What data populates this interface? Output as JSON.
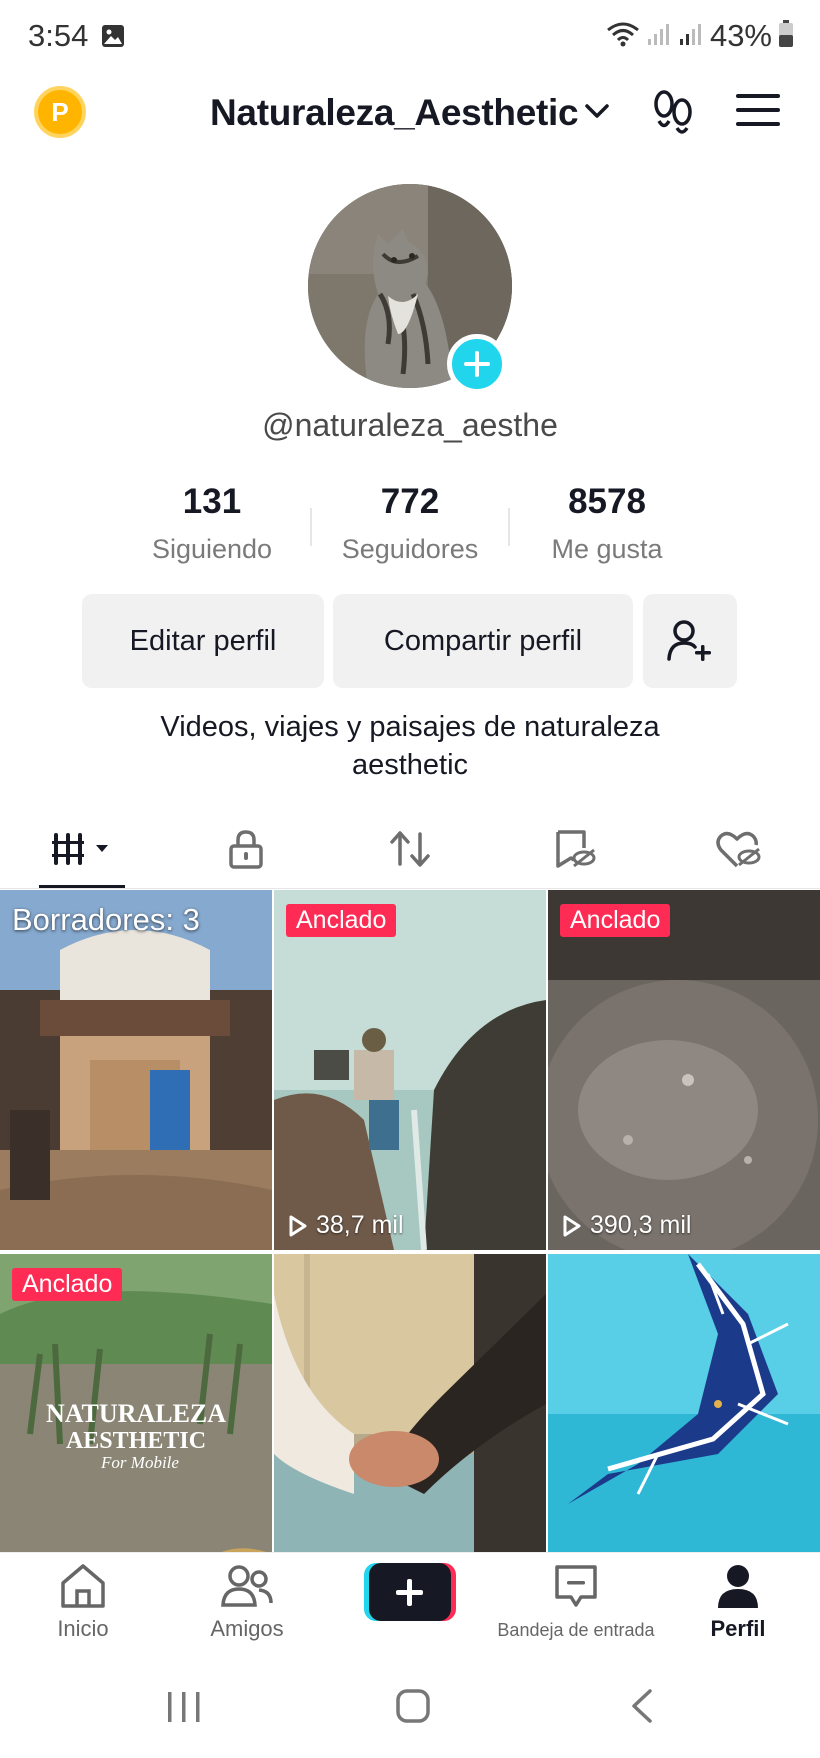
{
  "status_bar": {
    "time": "3:54",
    "battery": "43%"
  },
  "header": {
    "coin_letter": "P",
    "account_name": "Naturaleza_Aesthetic"
  },
  "profile": {
    "username": "@naturaleza_aesthe",
    "stats": [
      {
        "value": "131",
        "label": "Siguiendo"
      },
      {
        "value": "772",
        "label": "Seguidores"
      },
      {
        "value": "8578",
        "label": "Me gusta"
      }
    ],
    "edit_label": "Editar perfil",
    "share_label": "Compartir perfil",
    "bio_line1": "Videos, viajes y paisajes de naturaleza",
    "bio_line2": "aesthetic"
  },
  "grid": {
    "drafts_label": "Borradores: 3",
    "pinned_label": "Anclado",
    "items": [
      {
        "views": ""
      },
      {
        "views": "38,7 mil"
      },
      {
        "views": "390,3 mil"
      }
    ],
    "overlay_title": "NATURALEZA",
    "overlay_subtitle": "AESTHETIC",
    "overlay_script": "For Mobile"
  },
  "bottom_nav": {
    "home": "Inicio",
    "friends": "Amigos",
    "inbox": "Bandeja de entrada",
    "profile": "Perfil"
  },
  "colors": {
    "accent_pink": "#fe2c55",
    "accent_cyan": "#20d5ec"
  }
}
